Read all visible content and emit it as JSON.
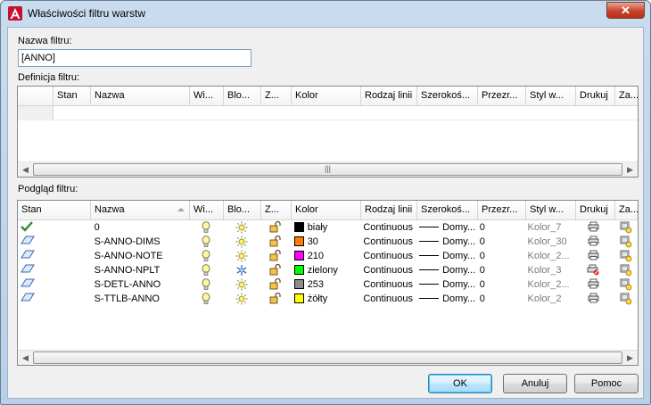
{
  "window": {
    "title": "Właściwości filtru warstw",
    "close_label": "✕"
  },
  "filter_name": {
    "label": "Nazwa filtru:",
    "value": "[ANNO]"
  },
  "definition": {
    "label": "Definicja filtru:",
    "columns": [
      "Stan",
      "Nazwa",
      "Wi...",
      "Blo...",
      "Z...",
      "Kolor",
      "Rodzaj linii",
      "Szerokoś...",
      "Przezr...",
      "Styl w...",
      "Drukuj",
      "Za..."
    ]
  },
  "preview": {
    "label": "Podgląd filtru:",
    "columns": [
      "Stan",
      "Nazwa",
      "Wi...",
      "Blo...",
      "Z...",
      "Kolor",
      "Rodzaj linii",
      "Szerokoś...",
      "Przezr...",
      "Styl w...",
      "Drukuj",
      "Za..."
    ],
    "rows": [
      {
        "state": "checkmark-icon",
        "name": "0",
        "color_name": "biały",
        "color_hex": "#000000",
        "linetype": "Continuous",
        "lineweight": "Domy...",
        "transparency": "0",
        "plot_style": "Kolor_7",
        "plot": "printer-icon",
        "frozen": "sun-icon"
      },
      {
        "state": "layer-icon",
        "name": "S-ANNO-DIMS",
        "color_name": "30",
        "color_hex": "#ff7f00",
        "linetype": "Continuous",
        "lineweight": "Domy...",
        "transparency": "0",
        "plot_style": "Kolor_30",
        "plot": "printer-icon",
        "frozen": "sun-icon"
      },
      {
        "state": "layer-icon",
        "name": "S-ANNO-NOTE",
        "color_name": "210",
        "color_hex": "#ff00ff",
        "linetype": "Continuous",
        "lineweight": "Domy...",
        "transparency": "0",
        "plot_style": "Kolor_2...",
        "plot": "printer-icon",
        "frozen": "sun-icon"
      },
      {
        "state": "layer-icon",
        "name": "S-ANNO-NPLT",
        "color_name": "zielony",
        "color_hex": "#00ff00",
        "linetype": "Continuous",
        "lineweight": "Domy...",
        "transparency": "0",
        "plot_style": "Kolor_3",
        "plot": "no-print-icon",
        "frozen": "snowflake-icon"
      },
      {
        "state": "layer-icon",
        "name": "S-DETL-ANNO",
        "color_name": "253",
        "color_hex": "#8c8c8c",
        "linetype": "Continuous",
        "lineweight": "Domy...",
        "transparency": "0",
        "plot_style": "Kolor_2...",
        "plot": "printer-icon",
        "frozen": "sun-icon"
      },
      {
        "state": "layer-icon",
        "name": "S-TTLB-ANNO",
        "color_name": "żółty",
        "color_hex": "#ffff00",
        "linetype": "Continuous",
        "lineweight": "Domy...",
        "transparency": "0",
        "plot_style": "Kolor_2",
        "plot": "printer-icon",
        "frozen": "sun-icon"
      }
    ]
  },
  "buttons": {
    "ok": "OK",
    "cancel": "Anuluj",
    "help": "Pomoc"
  }
}
